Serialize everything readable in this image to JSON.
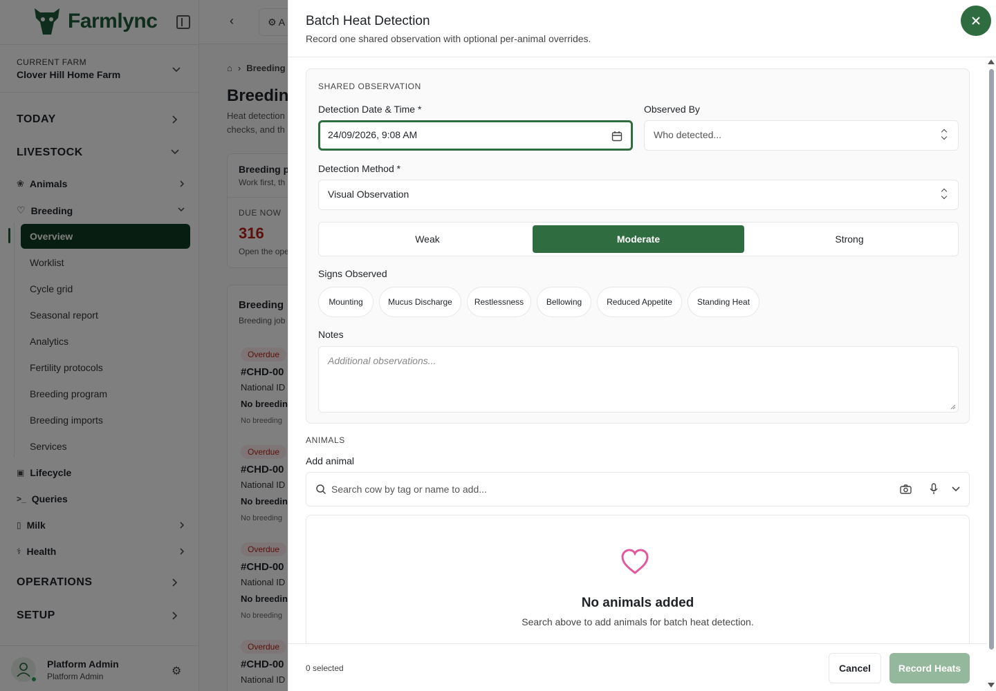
{
  "sidebar": {
    "brand": "Farmlync",
    "current_farm_label": "CURRENT FARM",
    "current_farm_name": "Clover Hill Home Farm",
    "sections": {
      "today": "TODAY",
      "livestock": "LIVESTOCK",
      "operations": "OPERATIONS",
      "setup": "SETUP"
    },
    "items": {
      "animals": "Animals",
      "breeding": "Breeding",
      "lifecycle": "Lifecycle",
      "queries": "Queries",
      "milk": "Milk",
      "health": "Health"
    },
    "breeding_sub": [
      "Overview",
      "Worklist",
      "Cycle grid",
      "Seasonal report",
      "Analytics",
      "Fertility protocols",
      "Breeding program",
      "Breeding imports",
      "Services"
    ],
    "user": {
      "name": "Platform Admin",
      "role": "Platform Admin"
    }
  },
  "main": {
    "tab_label": "A",
    "breadcrumb": "Breeding",
    "title": "Breedin",
    "description": "Heat detection checks, and th",
    "plan_card": {
      "title": "Breeding p",
      "subtitle": "Work first, th"
    },
    "due_now": {
      "label": "DUE NOW",
      "value": "316",
      "note": "Open the ope"
    },
    "jobs_card": {
      "title": "Breeding",
      "subtitle": "Breeding job"
    },
    "rows": [
      {
        "badge": "Overdue",
        "id": "#CHD-00",
        "nat": "National ID",
        "nb": "No breedin",
        "nb2": "No breeding"
      },
      {
        "badge": "Overdue",
        "id": "#CHD-00",
        "nat": "National ID",
        "nb": "No breedin",
        "nb2": "No breeding"
      },
      {
        "badge": "Overdue",
        "id": "#CHD-00",
        "nat": "National ID",
        "nb": "No breedin",
        "nb2": "No breeding"
      },
      {
        "badge": "Overdue",
        "id": "#CHD-00",
        "nat": "National ID"
      }
    ]
  },
  "panel": {
    "title": "Batch Heat Detection",
    "subtitle": "Record one shared observation with optional per-animal overrides.",
    "shared_title": "SHARED OBSERVATION",
    "detection_datetime_label": "Detection Date & Time *",
    "detection_datetime_value": "24/09/2026, 9:08 AM",
    "observed_by_label": "Observed By",
    "observed_by_placeholder": "Who detected...",
    "method_label": "Detection Method *",
    "method_value": "Visual Observation",
    "intensity": [
      "Weak",
      "Moderate",
      "Strong"
    ],
    "intensity_selected": "Moderate",
    "signs_label": "Signs Observed",
    "signs": [
      "Mounting",
      "Mucus Discharge",
      "Restlessness",
      "Bellowing",
      "Reduced Appetite",
      "Standing Heat"
    ],
    "notes_label": "Notes",
    "notes_placeholder": "Additional observations...",
    "animals_title": "ANIMALS",
    "add_animal_label": "Add animal",
    "search_placeholder": "Search cow by tag or name to add...",
    "empty_title": "No animals added",
    "empty_text": "Search above to add animals for batch heat detection.",
    "selected_count": "0 selected",
    "cancel_label": "Cancel",
    "record_label": "Record Heats"
  },
  "colors": {
    "brand": "#2f6d41",
    "brand_dark": "#0f3a24",
    "empty_heart": "#e0599c",
    "overdue": "#b42318"
  }
}
